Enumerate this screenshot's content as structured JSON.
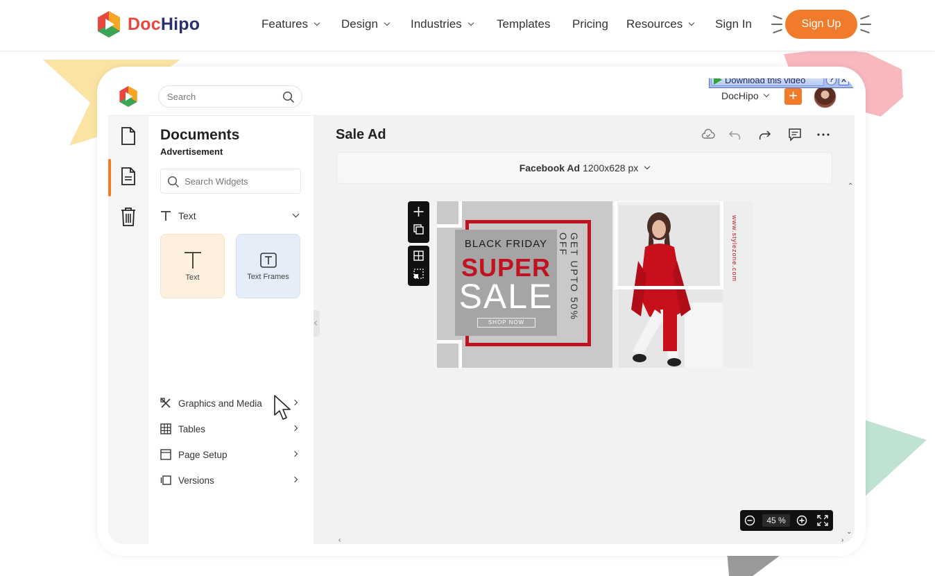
{
  "site": {
    "brand_doc": "Doc",
    "brand_hipo": "Hipo",
    "nav": [
      {
        "label": "Features",
        "dropdown": true
      },
      {
        "label": "Design",
        "dropdown": true
      },
      {
        "label": "Industries",
        "dropdown": true
      },
      {
        "label": "Templates",
        "dropdown": false
      },
      {
        "label": "Pricing",
        "dropdown": false
      },
      {
        "label": "Resources",
        "dropdown": true
      }
    ],
    "sign_in": "Sign In",
    "sign_up": "Sign Up",
    "accent": "#f07b2a"
  },
  "download_bar": {
    "label": "Download this video",
    "help": "?",
    "close": "X"
  },
  "app": {
    "search_placeholder": "Search",
    "account": "DocHipo",
    "add": "+"
  },
  "panel": {
    "title": "Documents",
    "subtitle": "Advertisement",
    "widget_search_placeholder": "Search Widgets",
    "text_section": "Text",
    "tiles": [
      {
        "label": "Text"
      },
      {
        "label": "Text Frames"
      }
    ],
    "menu": [
      {
        "label": "Graphics and Media"
      },
      {
        "label": "Tables"
      },
      {
        "label": "Page Setup"
      },
      {
        "label": "Versions"
      }
    ]
  },
  "editor": {
    "doc_title": "Sale Ad",
    "size_name": "Facebook Ad",
    "size_dims": "1200x628 px",
    "zoom_value": "45 %"
  },
  "ad": {
    "line1": "BLACK FRIDAY",
    "line2": "SUPER",
    "line3": "SALE",
    "cta": "SHOP NOW",
    "offer": "GET UPTO 50% OFF",
    "url": "www.stylezone.com",
    "red": "#c1121f"
  }
}
